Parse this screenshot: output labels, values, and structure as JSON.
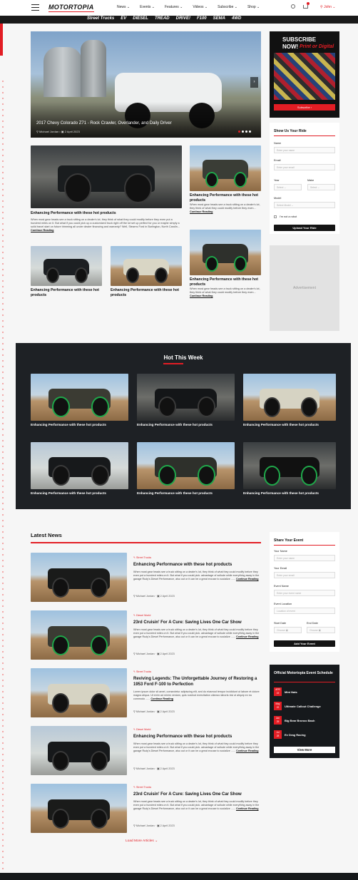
{
  "header": {
    "logo": "MOTORTOPIA",
    "nav": [
      "News",
      "Events",
      "Features",
      "Videos",
      "Subscribe",
      "Shop"
    ],
    "user": "John"
  },
  "brands": [
    "Street Trucks",
    "EV",
    "DIESEL",
    "TREAD",
    "DRIVE!",
    "F100",
    "SEMA",
    "4WD"
  ],
  "hero": {
    "title": "2017 Chevy Colorado Z71 - Rock Crawler, Overlander, and Daily Driver",
    "author": "Michael Jordan",
    "date": "2 April 2023"
  },
  "featured": {
    "title": "Enhancing Performance with these hot products",
    "desc": "When most gear heads see a truck sitting on a dealer's lot, they think of what they could modify before they even put a hundred miles on it. But what if you could pick up a customized truck right off the lot set up perfect for you or maybe simply a solid travel start on future trimming all under dealer financing and warranty? Well, Stearns Ford in Burlington, North Carolin...",
    "more": "Continue Reading"
  },
  "cards": [
    {
      "title": "Enhancing Performance with these hot products",
      "desc": "When most gear heads see a truck sitting on a dealer's lot, they think of what they could modify before they even...",
      "more": "Continue Reading"
    },
    {
      "title": "Enhancing Performance with these hot products",
      "desc": "When most gear heads see a truck sitting on a dealer's lot, they think of what they could modify before they even...",
      "more": "Continue Reading"
    },
    {
      "title": "Enhancing Performance with these hot products"
    },
    {
      "title": "Enhancing Performance with these hot products"
    }
  ],
  "subscribe": {
    "line1": "SUBSCRIBE",
    "line2": "NOW!",
    "line3": "Print or Digital",
    "button": "Subscribe"
  },
  "ride": {
    "title": "Show Us Your Ride",
    "name_label": "Name",
    "name_ph": "Enter your name",
    "email_label": "Email",
    "email_ph": "Enter your email",
    "year_label": "Year",
    "make_label": "Make",
    "select": "Select",
    "model_label": "Model",
    "model_ph": "Select Model",
    "robot": "I'm not a robot",
    "button": "Upload Your Ride"
  },
  "ad": "Advertisement",
  "hot": {
    "title": "Hot This Week",
    "items": [
      "Enhancing Performance with these hot products",
      "Enhancing Performance with these hot products",
      "Enhancing Performance with these hot products",
      "Enhancing Performance with these hot products",
      "Enhancing Performance with these hot products",
      "Enhancing Performance with these hot products"
    ]
  },
  "news": {
    "title": "Latest News",
    "articles": [
      {
        "cat": "Street Trucks",
        "title": "Enhancing Performance with these hot products",
        "desc": "When most gear heads see a truck sitting on a dealer's lot, they think of what they could modify before they even put a hundred miles on it. But what if you could pick. advantage of sollude while everything away in the garage Rudy's Diesel Performance, also out or it can be a great excuse to socialize ......",
        "more": "Continue Reading",
        "author": "Michael Jordan",
        "date": "2 April 2023"
      },
      {
        "cat": "Diesel World",
        "title": "23rd Cruisin' For A Cure: Saving Lives One Car Show",
        "desc": "When most gear heads see a truck sitting on a dealer's lot, they think of what they could modify before they even put a hundred miles on it. But what if you could pick. advantage of sollude while everything away in the garage Rudy's Diesel Performance, also out or it can be a great excuse to socialize ......",
        "more": "Continue Reading",
        "author": "Michael Jordan",
        "date": "2 April 2023"
      },
      {
        "cat": "Street Trucks",
        "title": "Reviving Legends: The Unforgettable Journey of Restoring a 1953 Ford F-100 to Perfection",
        "desc": "Lorem ipsum dolor sit amet, consectetur adipiscing elit, sed do eiusmod tempor incididunt ut labore et dolore magna aliqua. Ut enim ad minim veniam, quis nostrud exercitation ullamco laboris nisi ut aliquip ex ea commodo ......",
        "more": "Continue Reading",
        "author": "Michael Jordan",
        "date": "2 April 2023"
      },
      {
        "cat": "Diesel World",
        "title": "Enhancing Performance with these hot products",
        "desc": "When most gear heads see a truck sitting on a dealer's lot, they think of what they could modify before they even put a hundred miles on it. But what if you could pick. advantage of sollude while everything away in the garage Rudy's Diesel Performance, also out or it can be a great excuse to socialize ......",
        "more": "Continue Reading",
        "author": "Michael Jordan",
        "date": "2 April 2023"
      },
      {
        "cat": "Street Trucks",
        "title": "23rd Cruisin' For A Cure: Saving Lives One Car Show",
        "desc": "When most gear heads see a truck sitting on a dealer's lot, they think of what they could modify before they even put a hundred miles on it. But what if you could pick. advantage of sollude while everything away in the garage Rudy's Diesel Performance, also out or it can be a great excuse to socialize ......",
        "more": "Continue Reading",
        "author": "Michael Jordan",
        "date": "2 April 2023"
      }
    ],
    "load_more": "Load More Articles"
  },
  "share": {
    "title": "Share Your Event",
    "name_label": "Your Name",
    "name_ph": "Enter your name",
    "email_label": "Your Email",
    "email_ph": "Enter your email",
    "event_label": "Event Name",
    "event_ph": "Enter your event name",
    "loc_label": "Event Location",
    "loc_ph": "Location of event",
    "start_label": "Start Date",
    "end_label": "End Date",
    "choose": "Choose",
    "button": "Add Your Event"
  },
  "schedule": {
    "title": "Official Motortopia Event Schedule",
    "events": [
      {
        "mon": "APR",
        "day": "19",
        "name": "Mini Nats"
      },
      {
        "mon": "May",
        "day": "22",
        "name": "Ultimate Callout Challenge"
      },
      {
        "mon": "Jun",
        "day": "29",
        "name": "Big Bear Bronco Bash"
      },
      {
        "mon": "Jul",
        "day": "28",
        "name": "Ev Drag Racing"
      }
    ],
    "button": "View More"
  }
}
